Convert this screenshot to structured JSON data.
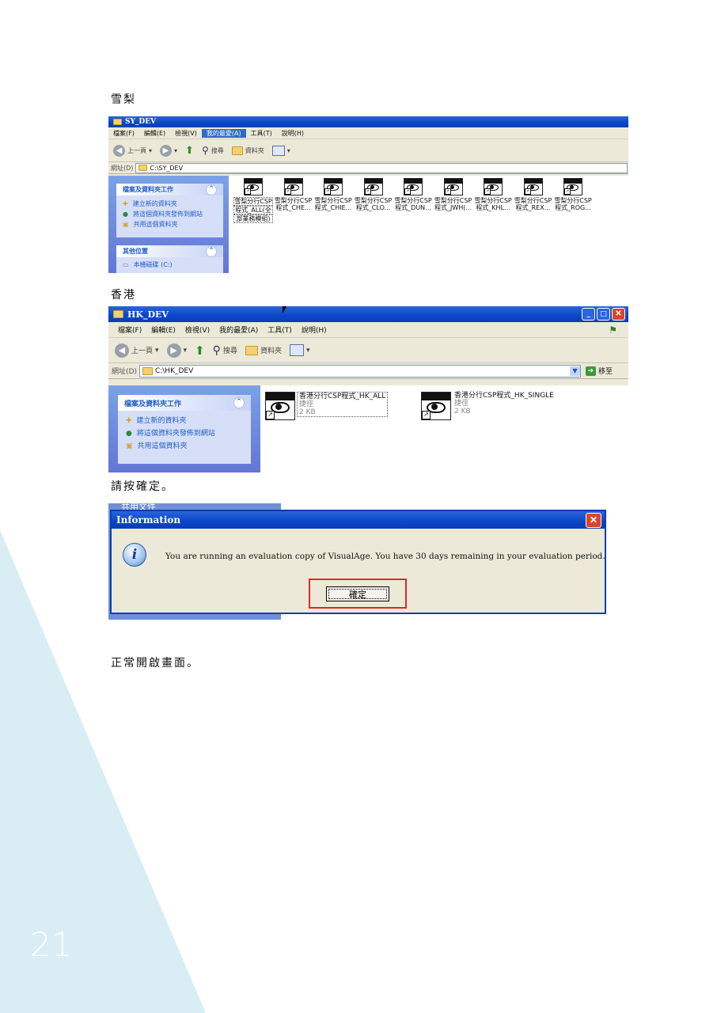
{
  "paragraphs": {
    "sy_heading": "雪梨",
    "hk_heading": "香港",
    "confirm_note": "請按確定。",
    "normal_note": "正常開啟畫面。"
  },
  "page_number": "21",
  "sy_window": {
    "title": "SY_DEV",
    "menu": [
      "檔案(F)",
      "編輯(E)",
      "檢視(V)",
      "我的最愛(A)",
      "工具(T)",
      "說明(H)"
    ],
    "selected_menu_index": 3,
    "toolbar": {
      "back": "上一頁",
      "search": "搜尋",
      "folders": "資料夾"
    },
    "address_label": "網址(D)",
    "address_value": "C:\\SY_DEV",
    "task_panel_title": "檔案及資料夾工作",
    "tasks": [
      "建立新的資料夾",
      "將這個資料夾發佈到網站",
      "共用這個資料夾"
    ],
    "other_panel_title": "其他位置",
    "other_items": [
      "本機磁碟 (C:)"
    ],
    "files": [
      {
        "l1": "雪梨分行CSP",
        "l2": "程式_ALL(全",
        "l3": "部業務模組)"
      },
      {
        "l1": "雪梨分行CSP",
        "l2": "程式_CHE..."
      },
      {
        "l1": "雪梨分行CSP",
        "l2": "程式_CHIE..."
      },
      {
        "l1": "雪梨分行CSP",
        "l2": "程式_CLO..."
      },
      {
        "l1": "雪梨分行CSP",
        "l2": "程式_DUN..."
      },
      {
        "l1": "雪梨分行CSP",
        "l2": "程式_JWH(..."
      },
      {
        "l1": "雪梨分行CSP",
        "l2": "程式_KHL..."
      },
      {
        "l1": "雪梨分行CSP",
        "l2": "程式_REX..."
      },
      {
        "l1": "雪梨分行CSP",
        "l2": "程式_ROG..."
      }
    ]
  },
  "hk_window": {
    "title": "HK_DEV",
    "menu": [
      "檔案(F)",
      "編輯(E)",
      "檢視(V)",
      "我的最愛(A)",
      "工具(T)",
      "說明(H)"
    ],
    "toolbar": {
      "back": "上一頁",
      "search": "搜尋",
      "folders": "資料夾"
    },
    "address_label": "網址(D)",
    "address_value": "C:\\HK_DEV",
    "go_label": "移至",
    "task_panel_title": "檔案及資料夾工作",
    "tasks": [
      "建立新的資料夾",
      "將這個資料夾發佈到網站",
      "共用這個資料夾"
    ],
    "files": [
      {
        "name": "香港分行CSP程式_HK_ALL",
        "type": "捷徑",
        "size": "2 KB"
      },
      {
        "name": "香港分行CSP程式_HK_SINGLE",
        "type": "捷徑",
        "size": "2 KB"
      }
    ]
  },
  "dialog": {
    "background_fragment": "共用文件",
    "title": "Information",
    "message": "You are running an evaluation copy of VisualAge.  You have 30 days remaining in your evaluation period.",
    "ok_label": "確定",
    "highlight_color": "#e0282b"
  },
  "colors": {
    "corner": "#d9edf4",
    "xp_title": "#0a46c8",
    "xp_face": "#ece9d8"
  }
}
